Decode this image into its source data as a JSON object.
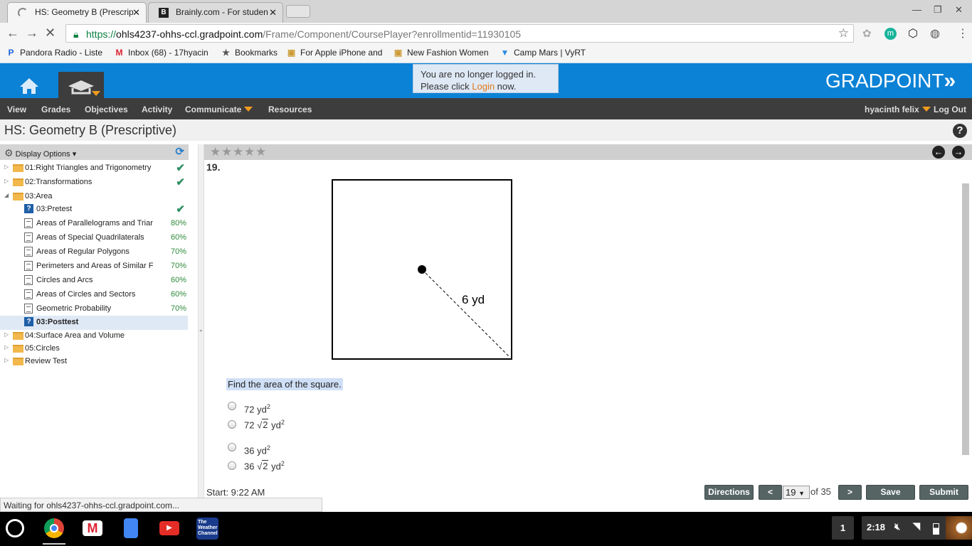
{
  "browser": {
    "tabs": [
      {
        "title": "HS: Geometry B (Prescrip",
        "active": true
      },
      {
        "title": "Brainly.com - For studen",
        "active": false
      }
    ],
    "url_scheme": "https://",
    "url_host": "ohls4237-ohhs-ccl.gradpoint.com",
    "url_path": "/Frame/Component/CoursePlayer?enrollmentid=11930105",
    "bookmarks": [
      "Pandora Radio - Liste",
      "Inbox (68) - 17hyacin",
      "Bookmarks",
      "For Apple iPhone and",
      "New Fashion Women",
      "Camp Mars | VyRT"
    ],
    "extension_badge": "m",
    "status": "Waiting for ohls4237-ohhs-ccl.gradpoint.com..."
  },
  "header": {
    "logo": "GRADPOINT",
    "notice_line1": "You are no longer logged in.",
    "notice_pre": "Please click ",
    "notice_link": "Login",
    "notice_post": " now.",
    "accent": "#0b82d6"
  },
  "nav": {
    "items": [
      "View",
      "Grades",
      "Objectives",
      "Activity",
      "Communicate",
      "Resources"
    ],
    "user": "hyacinth felix",
    "logout": "Log Out"
  },
  "page_title": "HS: Geometry B (Prescriptive)",
  "sidebar": {
    "display_options": "Display Options",
    "items": [
      {
        "label": "01:Right Triangles and Trigonometry",
        "type": "folder",
        "status": "check"
      },
      {
        "label": "02:Transformations",
        "type": "folder",
        "status": "check"
      },
      {
        "label": "03:Area",
        "type": "folder-open",
        "status": ""
      },
      {
        "label": "03:Pretest",
        "type": "test",
        "status": "check"
      },
      {
        "label": "Areas of Parallelograms and Triar",
        "type": "doc",
        "status": "80%"
      },
      {
        "label": "Areas of Special Quadrilaterals",
        "type": "doc",
        "status": "60%"
      },
      {
        "label": "Areas of Regular Polygons",
        "type": "doc",
        "status": "70%"
      },
      {
        "label": "Perimeters and Areas of Similar F",
        "type": "doc",
        "status": "70%"
      },
      {
        "label": "Circles and Arcs",
        "type": "doc",
        "status": "60%"
      },
      {
        "label": "Areas of Circles and Sectors",
        "type": "doc",
        "status": "60%"
      },
      {
        "label": "Geometric Probability",
        "type": "doc",
        "status": "70%"
      },
      {
        "label": "03:Posttest",
        "type": "test",
        "status": "",
        "selected": true
      },
      {
        "label": "04:Surface Area and Volume",
        "type": "folder",
        "status": ""
      },
      {
        "label": "05:Circles",
        "type": "folder",
        "status": ""
      },
      {
        "label": "Review Test",
        "type": "folder",
        "status": ""
      }
    ]
  },
  "question": {
    "number": "19.",
    "figure_label": "6 yd",
    "prompt": "Find the area of the square.",
    "answers": [
      {
        "coef": "72",
        "root": "",
        "unit": "yd",
        "exp": "2"
      },
      {
        "coef": "72",
        "root": "2",
        "unit": "yd",
        "exp": "2"
      },
      {
        "coef": "36",
        "root": "",
        "unit": "yd",
        "exp": "2"
      },
      {
        "coef": "36",
        "root": "2",
        "unit": "yd",
        "exp": "2"
      }
    ],
    "rating_stars": 5
  },
  "footer": {
    "start": "Start: 9:22 AM",
    "directions": "Directions",
    "prev": "<",
    "page": "19",
    "of": "of 35",
    "next": ">",
    "save": "Save",
    "submit": "Submit"
  },
  "taskbar": {
    "notifications": "1",
    "time": "2:18",
    "weather_app": "The Weather Channel"
  }
}
